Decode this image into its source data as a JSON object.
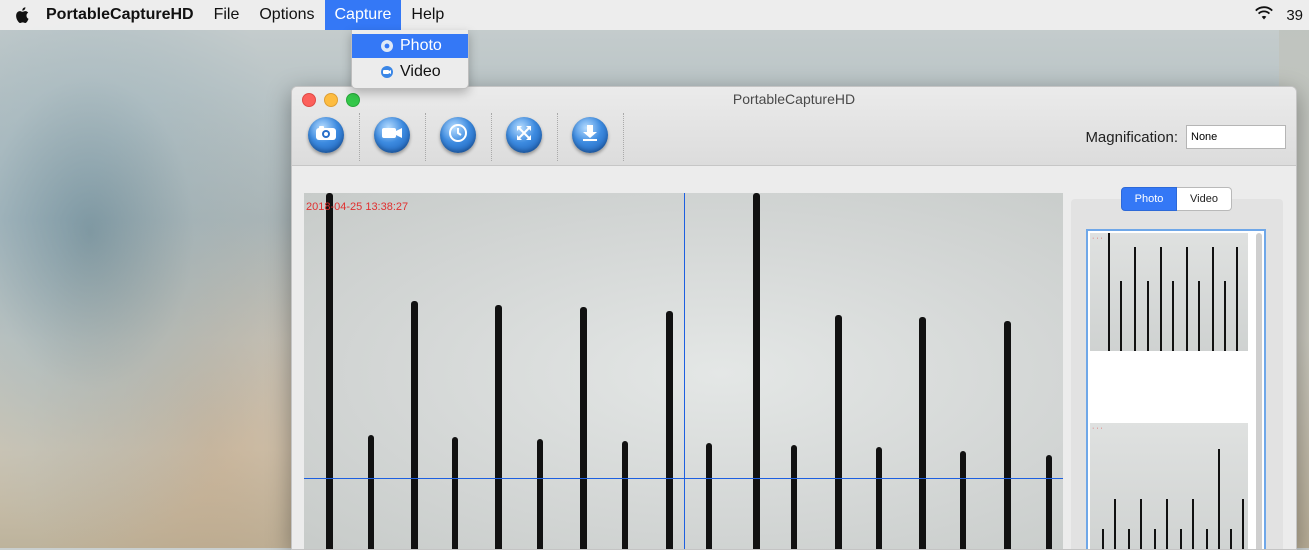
{
  "menubar": {
    "app_name": "PortableCaptureHD",
    "items": [
      "File",
      "Options",
      "Capture",
      "Help"
    ],
    "active_item": "Capture",
    "clock_partial": "39"
  },
  "capture_menu": {
    "items": [
      {
        "label": "Photo",
        "icon": "camera-icon",
        "selected": true
      },
      {
        "label": "Video",
        "icon": "video-icon",
        "selected": false
      }
    ]
  },
  "window": {
    "title": "PortableCaptureHD",
    "toolbar": [
      {
        "name": "snapshot",
        "icon": "camera-icon"
      },
      {
        "name": "record",
        "icon": "video-camera-icon"
      },
      {
        "name": "timer",
        "icon": "clock-icon"
      },
      {
        "name": "fullscreen",
        "icon": "expand-icon"
      },
      {
        "name": "save",
        "icon": "download-icon"
      }
    ],
    "magnification_label": "Magnification:",
    "magnification_value": "None"
  },
  "preview": {
    "timestamp": "2018-04-25 13:38:27"
  },
  "side_panel": {
    "tab_photo": "Photo",
    "tab_video": "Video",
    "active_tab": "Photo"
  },
  "colors": {
    "accent": "#3478f6",
    "crosshair": "#1d5fe0",
    "timestamp": "#e03030"
  }
}
